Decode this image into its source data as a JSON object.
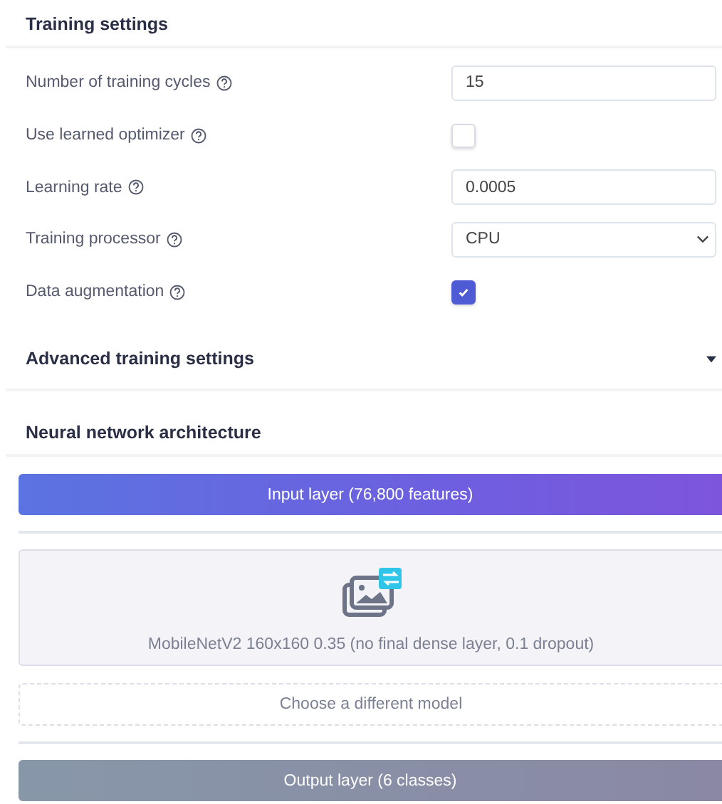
{
  "training_settings": {
    "title": "Training settings",
    "fields": [
      {
        "kind": "text",
        "label": "Number of training cycles",
        "value": "15"
      },
      {
        "kind": "checkbox",
        "label": "Use learned optimizer",
        "checked": false
      },
      {
        "kind": "text",
        "label": "Learning rate",
        "value": "0.0005"
      },
      {
        "kind": "select",
        "label": "Training processor",
        "value": "CPU"
      },
      {
        "kind": "checkbox",
        "label": "Data augmentation",
        "checked": true
      }
    ]
  },
  "advanced": {
    "title": "Advanced training settings",
    "expanded": false
  },
  "architecture": {
    "title": "Neural network architecture",
    "input_layer": "Input layer (76,800 features)",
    "model": "MobileNetV2 160x160 0.35 (no final dense layer, 0.1 dropout)",
    "choose_button": "Choose a different model",
    "output_layer": "Output layer (6 classes)"
  }
}
